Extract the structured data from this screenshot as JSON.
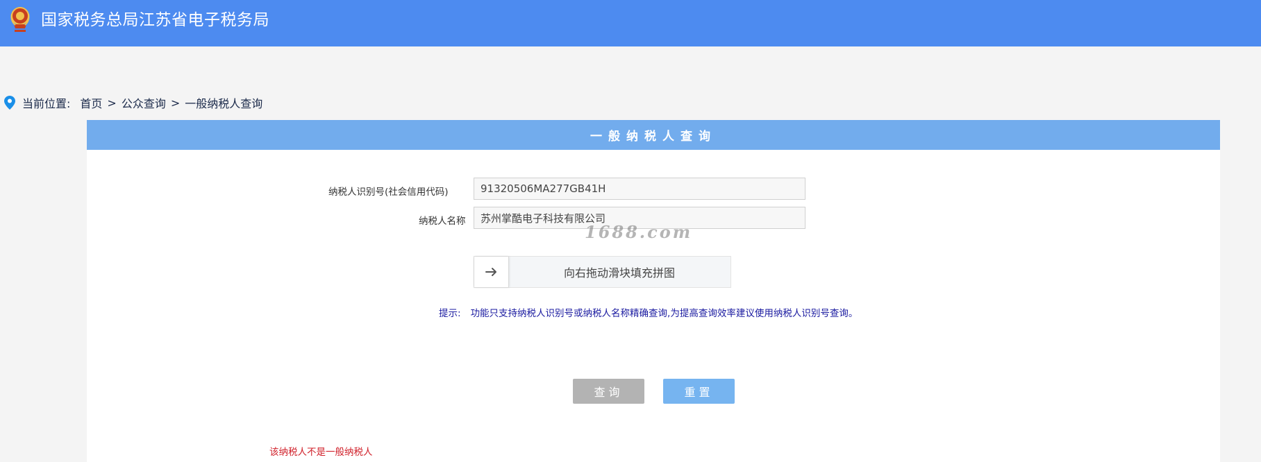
{
  "header": {
    "title": "国家税务总局江苏省电子税务局",
    "logo_icon": "tax-emblem-icon"
  },
  "breadcrumb": {
    "label": "当前位置:",
    "items": [
      "首页",
      "公众查询",
      "一般纳税人查询"
    ],
    "separator": ">",
    "icon": "location-pin-icon"
  },
  "panel": {
    "title": "一般纳税人查询"
  },
  "form": {
    "taxpayer_id": {
      "label": "纳税人识别号(社会信用代码)",
      "value": "91320506MA277GB41H"
    },
    "taxpayer_name": {
      "label": "纳税人名称",
      "value": "苏州掌酷电子科技有限公司"
    }
  },
  "watermark": "1688.com",
  "slider": {
    "text": "向右拖动滑块填充拼图",
    "handle_icon": "arrow-right-icon"
  },
  "tip": {
    "label": "提示:",
    "text": "功能只支持纳税人识别号或纳税人名称精确查询,为提高查询效率建议使用纳税人识别号查询。"
  },
  "buttons": {
    "query": "查询",
    "reset": "重置"
  },
  "result": {
    "message": "该纳税人不是一般纳税人"
  },
  "colors": {
    "header_bg": "#4d8bf0",
    "panel_head_bg": "#72aced",
    "query_button_bg": "#b3b3b3",
    "reset_button_bg": "#76b4f0",
    "tip_text": "#1a1aa0",
    "error_text": "#d0202a"
  }
}
